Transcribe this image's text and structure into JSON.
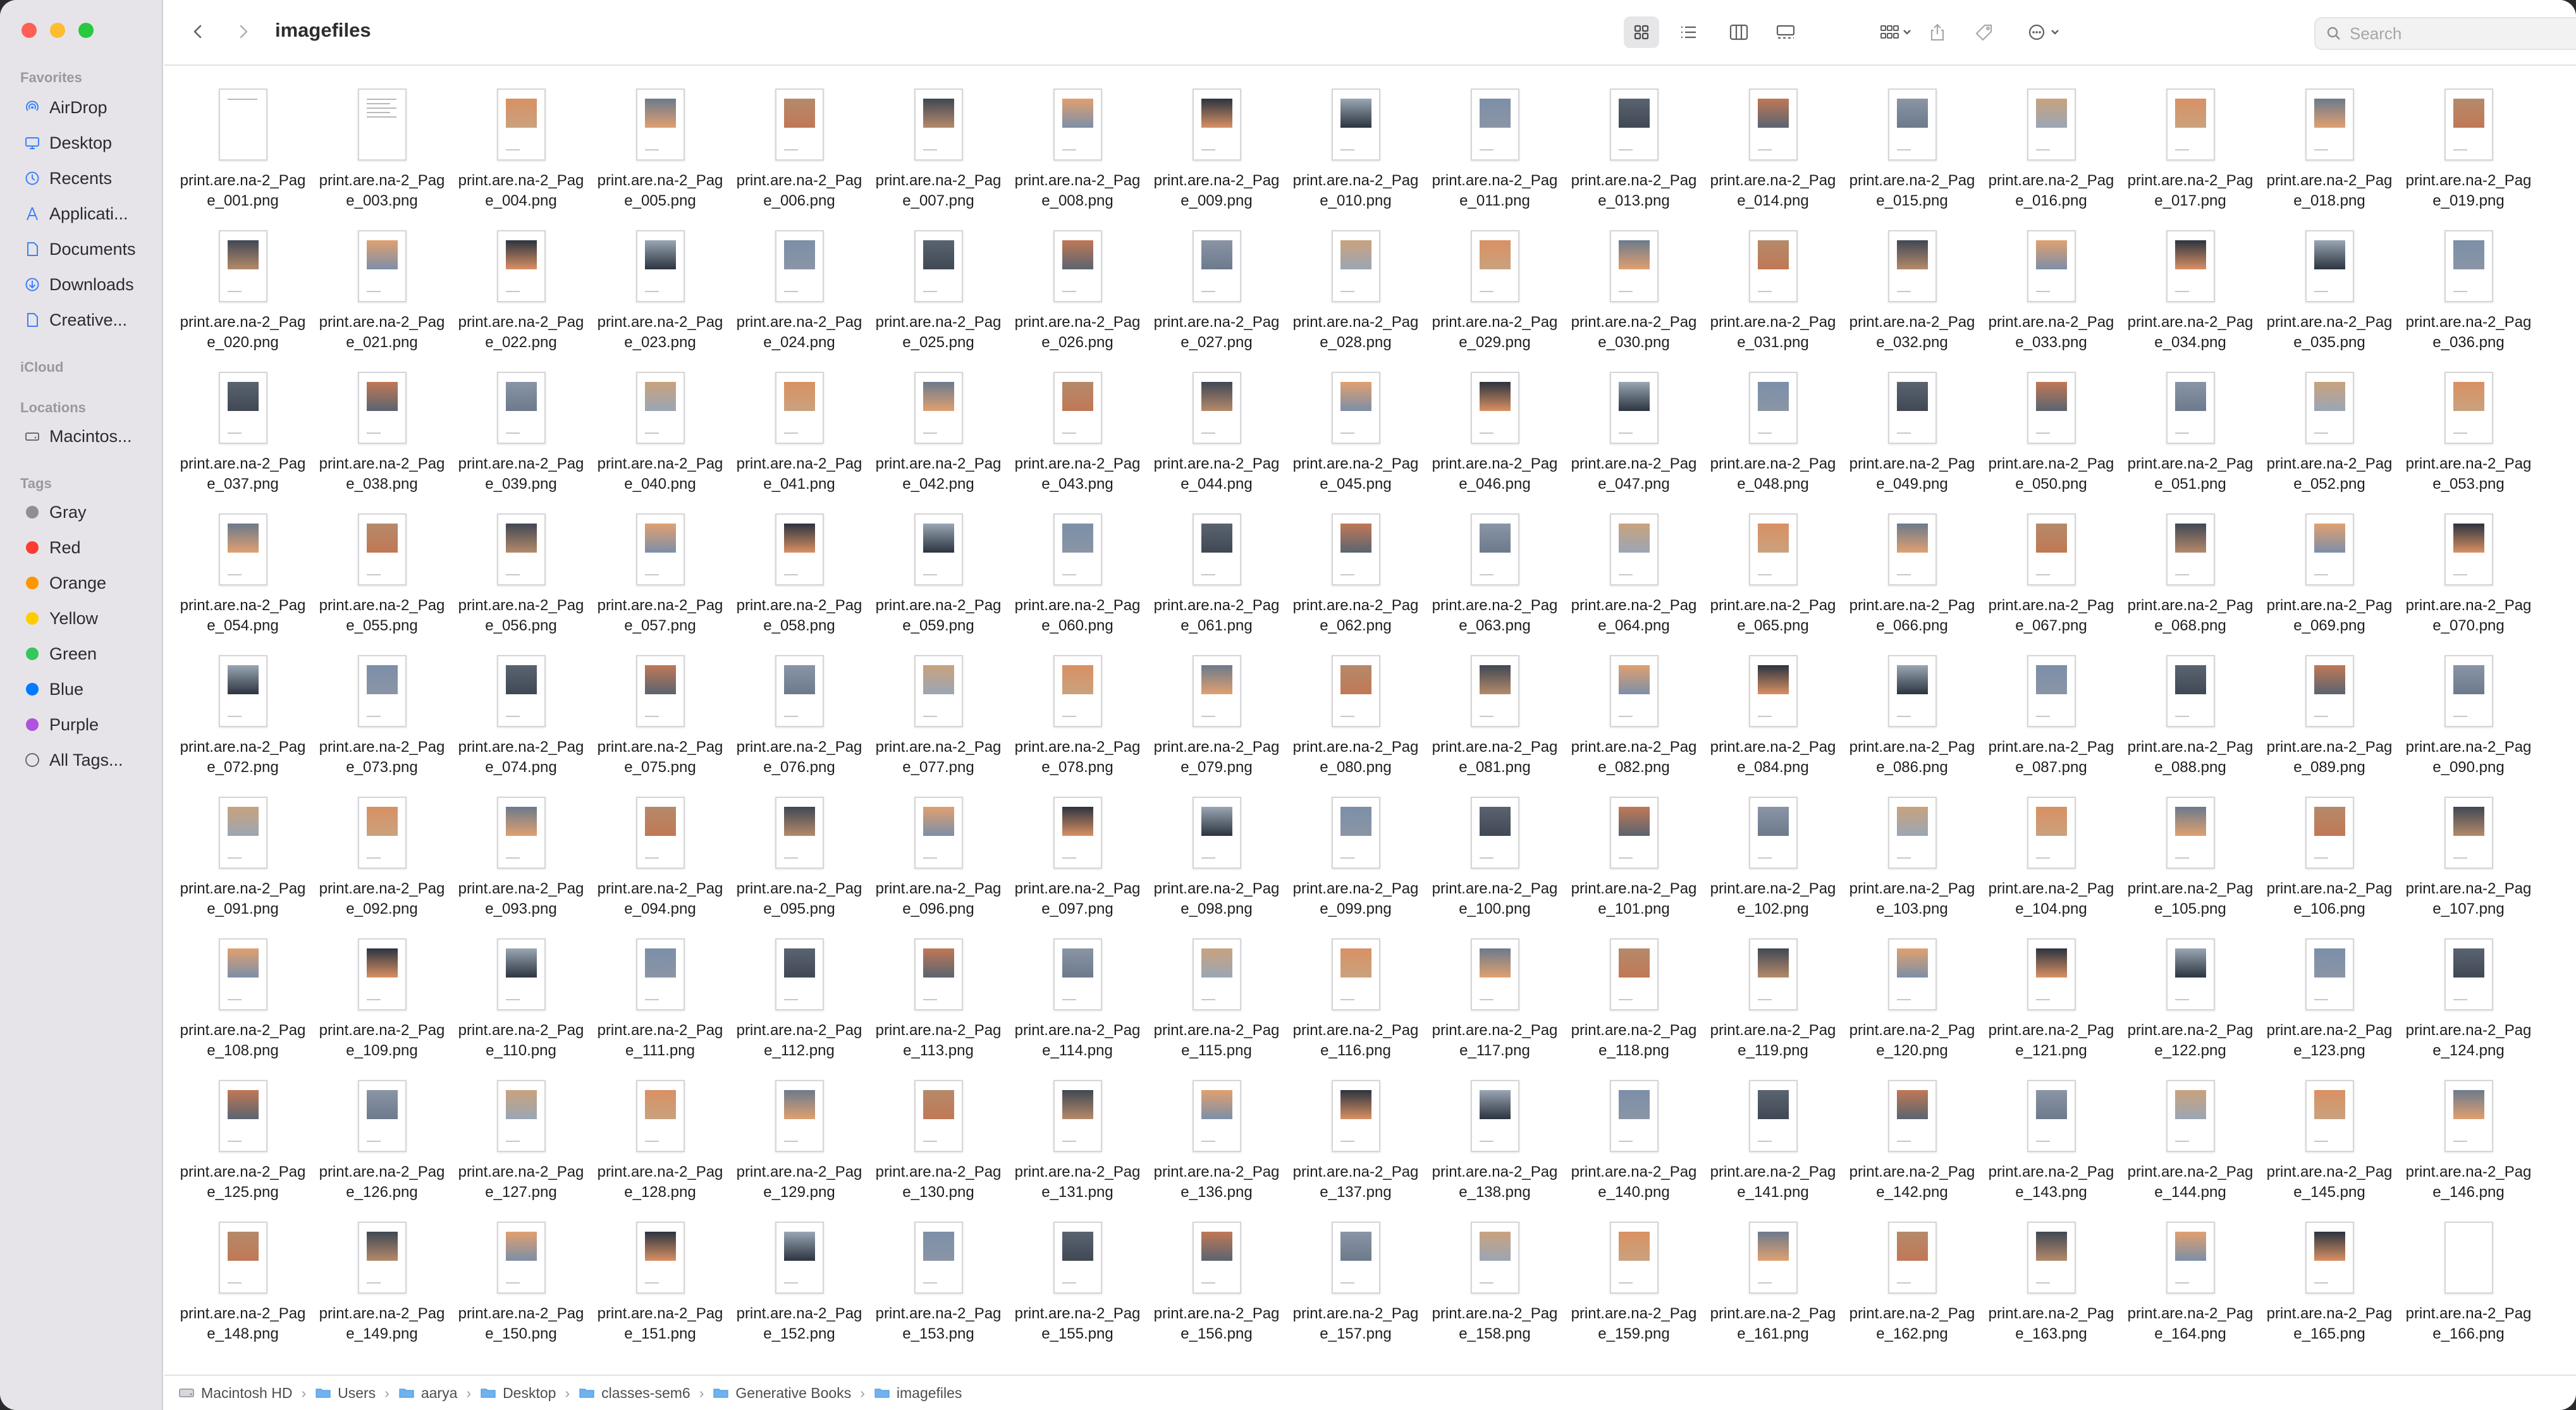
{
  "window": {
    "title": "imagefiles"
  },
  "sidebar": {
    "favorites_heading": "Favorites",
    "favorites": [
      {
        "label": "AirDrop",
        "icon": "airdrop-icon"
      },
      {
        "label": "Desktop",
        "icon": "desktop-icon"
      },
      {
        "label": "Recents",
        "icon": "clock-icon"
      },
      {
        "label": "Applicati...",
        "icon": "applications-icon"
      },
      {
        "label": "Documents",
        "icon": "document-icon"
      },
      {
        "label": "Downloads",
        "icon": "download-icon"
      },
      {
        "label": "Creative...",
        "icon": "document-icon"
      }
    ],
    "icloud_heading": "iCloud",
    "locations_heading": "Locations",
    "locations": [
      {
        "label": "Macintos...",
        "icon": "drive-icon"
      }
    ],
    "tags_heading": "Tags",
    "tags": [
      {
        "label": "Gray",
        "color": "#8e8e93"
      },
      {
        "label": "Red",
        "color": "#ff3b30"
      },
      {
        "label": "Orange",
        "color": "#ff9500"
      },
      {
        "label": "Yellow",
        "color": "#ffcc00"
      },
      {
        "label": "Green",
        "color": "#34c759"
      },
      {
        "label": "Blue",
        "color": "#007aff"
      },
      {
        "label": "Purple",
        "color": "#af52de"
      }
    ],
    "all_tags_label": "All Tags..."
  },
  "toolbar": {
    "search_placeholder": "Search",
    "view_mode": "icon"
  },
  "files": {
    "prefix": "print.are.na-2_Page_",
    "extension": ".png",
    "numbers": [
      "001",
      "003",
      "004",
      "005",
      "006",
      "007",
      "008",
      "009",
      "010",
      "011",
      "013",
      "014",
      "015",
      "016",
      "017",
      "018",
      "019",
      "020",
      "021",
      "022",
      "023",
      "024",
      "025",
      "026",
      "027",
      "028",
      "029",
      "030",
      "031",
      "032",
      "033",
      "034",
      "035",
      "036",
      "037",
      "038",
      "039",
      "040",
      "041",
      "042",
      "043",
      "044",
      "045",
      "046",
      "047",
      "048",
      "049",
      "050",
      "051",
      "052",
      "053",
      "054",
      "055",
      "056",
      "057",
      "058",
      "059",
      "060",
      "061",
      "062",
      "063",
      "064",
      "065",
      "066",
      "067",
      "068",
      "069",
      "070",
      "072",
      "073",
      "074",
      "075",
      "076",
      "077",
      "078",
      "079",
      "080",
      "081",
      "082",
      "084",
      "086",
      "087",
      "088",
      "089",
      "090",
      "091",
      "092",
      "093",
      "094",
      "095",
      "096",
      "097",
      "098",
      "099",
      "100",
      "101",
      "102",
      "103",
      "104",
      "105",
      "106",
      "107",
      "108",
      "109",
      "110",
      "111",
      "112",
      "113",
      "114",
      "115",
      "116",
      "117",
      "118",
      "119",
      "120",
      "121",
      "122",
      "123",
      "124",
      "125",
      "126",
      "127",
      "128",
      "129",
      "130",
      "131",
      "136",
      "137",
      "138",
      "140",
      "141",
      "142",
      "143",
      "144",
      "145",
      "146",
      "148",
      "149",
      "150",
      "151",
      "152",
      "153",
      "155",
      "156",
      "157",
      "158",
      "159",
      "161",
      "162",
      "163",
      "164",
      "165",
      "166"
    ]
  },
  "pathbar": {
    "crumbs": [
      {
        "label": "Macintosh HD",
        "icon": "drive-icon"
      },
      {
        "label": "Users",
        "icon": "folder-icon"
      },
      {
        "label": "aarya",
        "icon": "folder-icon"
      },
      {
        "label": "Desktop",
        "icon": "folder-icon"
      },
      {
        "label": "classes-sem6",
        "icon": "folder-icon"
      },
      {
        "label": "Generative Books",
        "icon": "folder-icon"
      },
      {
        "label": "imagefiles",
        "icon": "folder-icon"
      }
    ]
  }
}
